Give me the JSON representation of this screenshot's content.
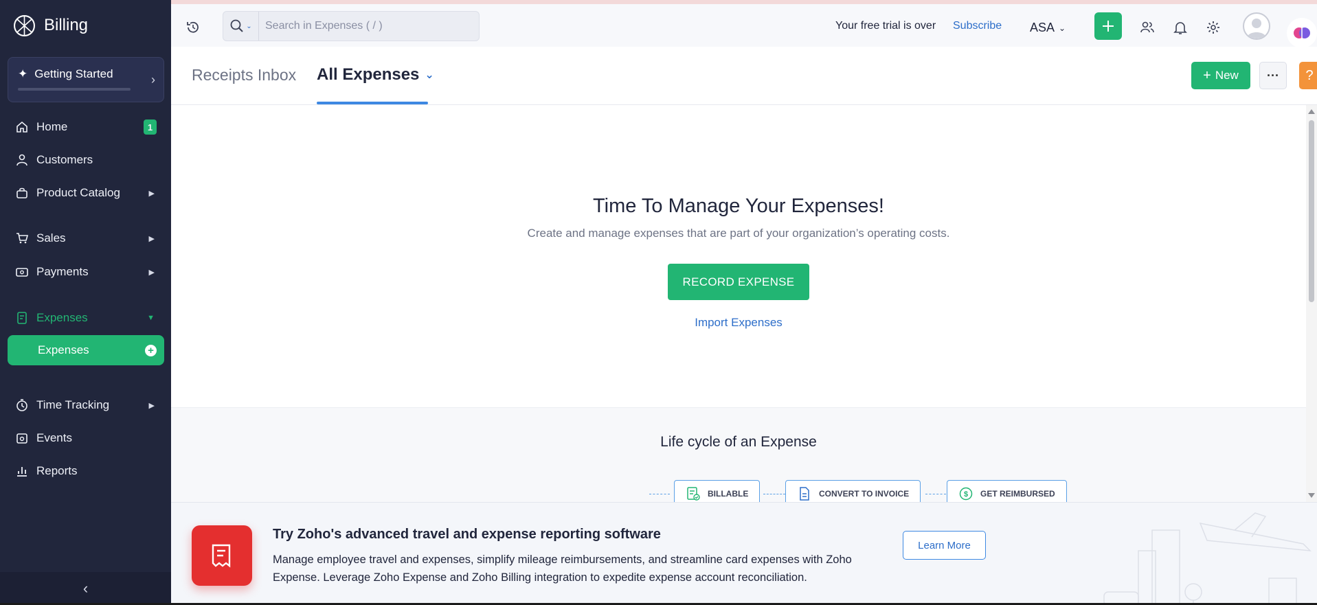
{
  "app": {
    "name": "Billing"
  },
  "sidebar": {
    "getting_started": "Getting Started",
    "items": [
      {
        "label": "Home",
        "badge": "1"
      },
      {
        "label": "Customers"
      },
      {
        "label": "Product Catalog"
      },
      {
        "label": "Sales"
      },
      {
        "label": "Payments"
      },
      {
        "label": "Expenses"
      },
      {
        "label": "Expenses"
      },
      {
        "label": "Time Tracking"
      },
      {
        "label": "Events"
      },
      {
        "label": "Reports"
      }
    ]
  },
  "header": {
    "search_placeholder": "Search in Expenses ( / )",
    "trial_text": "Your free trial is over",
    "subscribe": "Subscribe",
    "org": "ASA"
  },
  "tabs": {
    "receipts": "Receipts Inbox",
    "all_expenses": "All Expenses",
    "new_button": "New",
    "help": "?"
  },
  "main": {
    "title": "Time To Manage Your Expenses!",
    "subtitle": "Create and manage expenses that are part of your organization’s operating costs.",
    "record_button": "RECORD EXPENSE",
    "import_link": "Import Expenses",
    "lifecycle_title": "Life cycle of an Expense",
    "stages": [
      "BILLABLE",
      "CONVERT TO INVOICE",
      "GET REIMBURSED"
    ]
  },
  "promo": {
    "title": "Try Zoho's advanced travel and expense reporting software",
    "description": "Manage employee travel and expenses, simplify mileage reimbursements, and streamline card expenses with Zoho Expense. Leverage Zoho Expense and Zoho Billing integration to expedite expense account reconciliation.",
    "learn_more": "Learn More"
  },
  "colors": {
    "accent": "#22b573",
    "sidebar": "#21263c",
    "link": "#2d6ec9",
    "help": "#f3933a"
  }
}
